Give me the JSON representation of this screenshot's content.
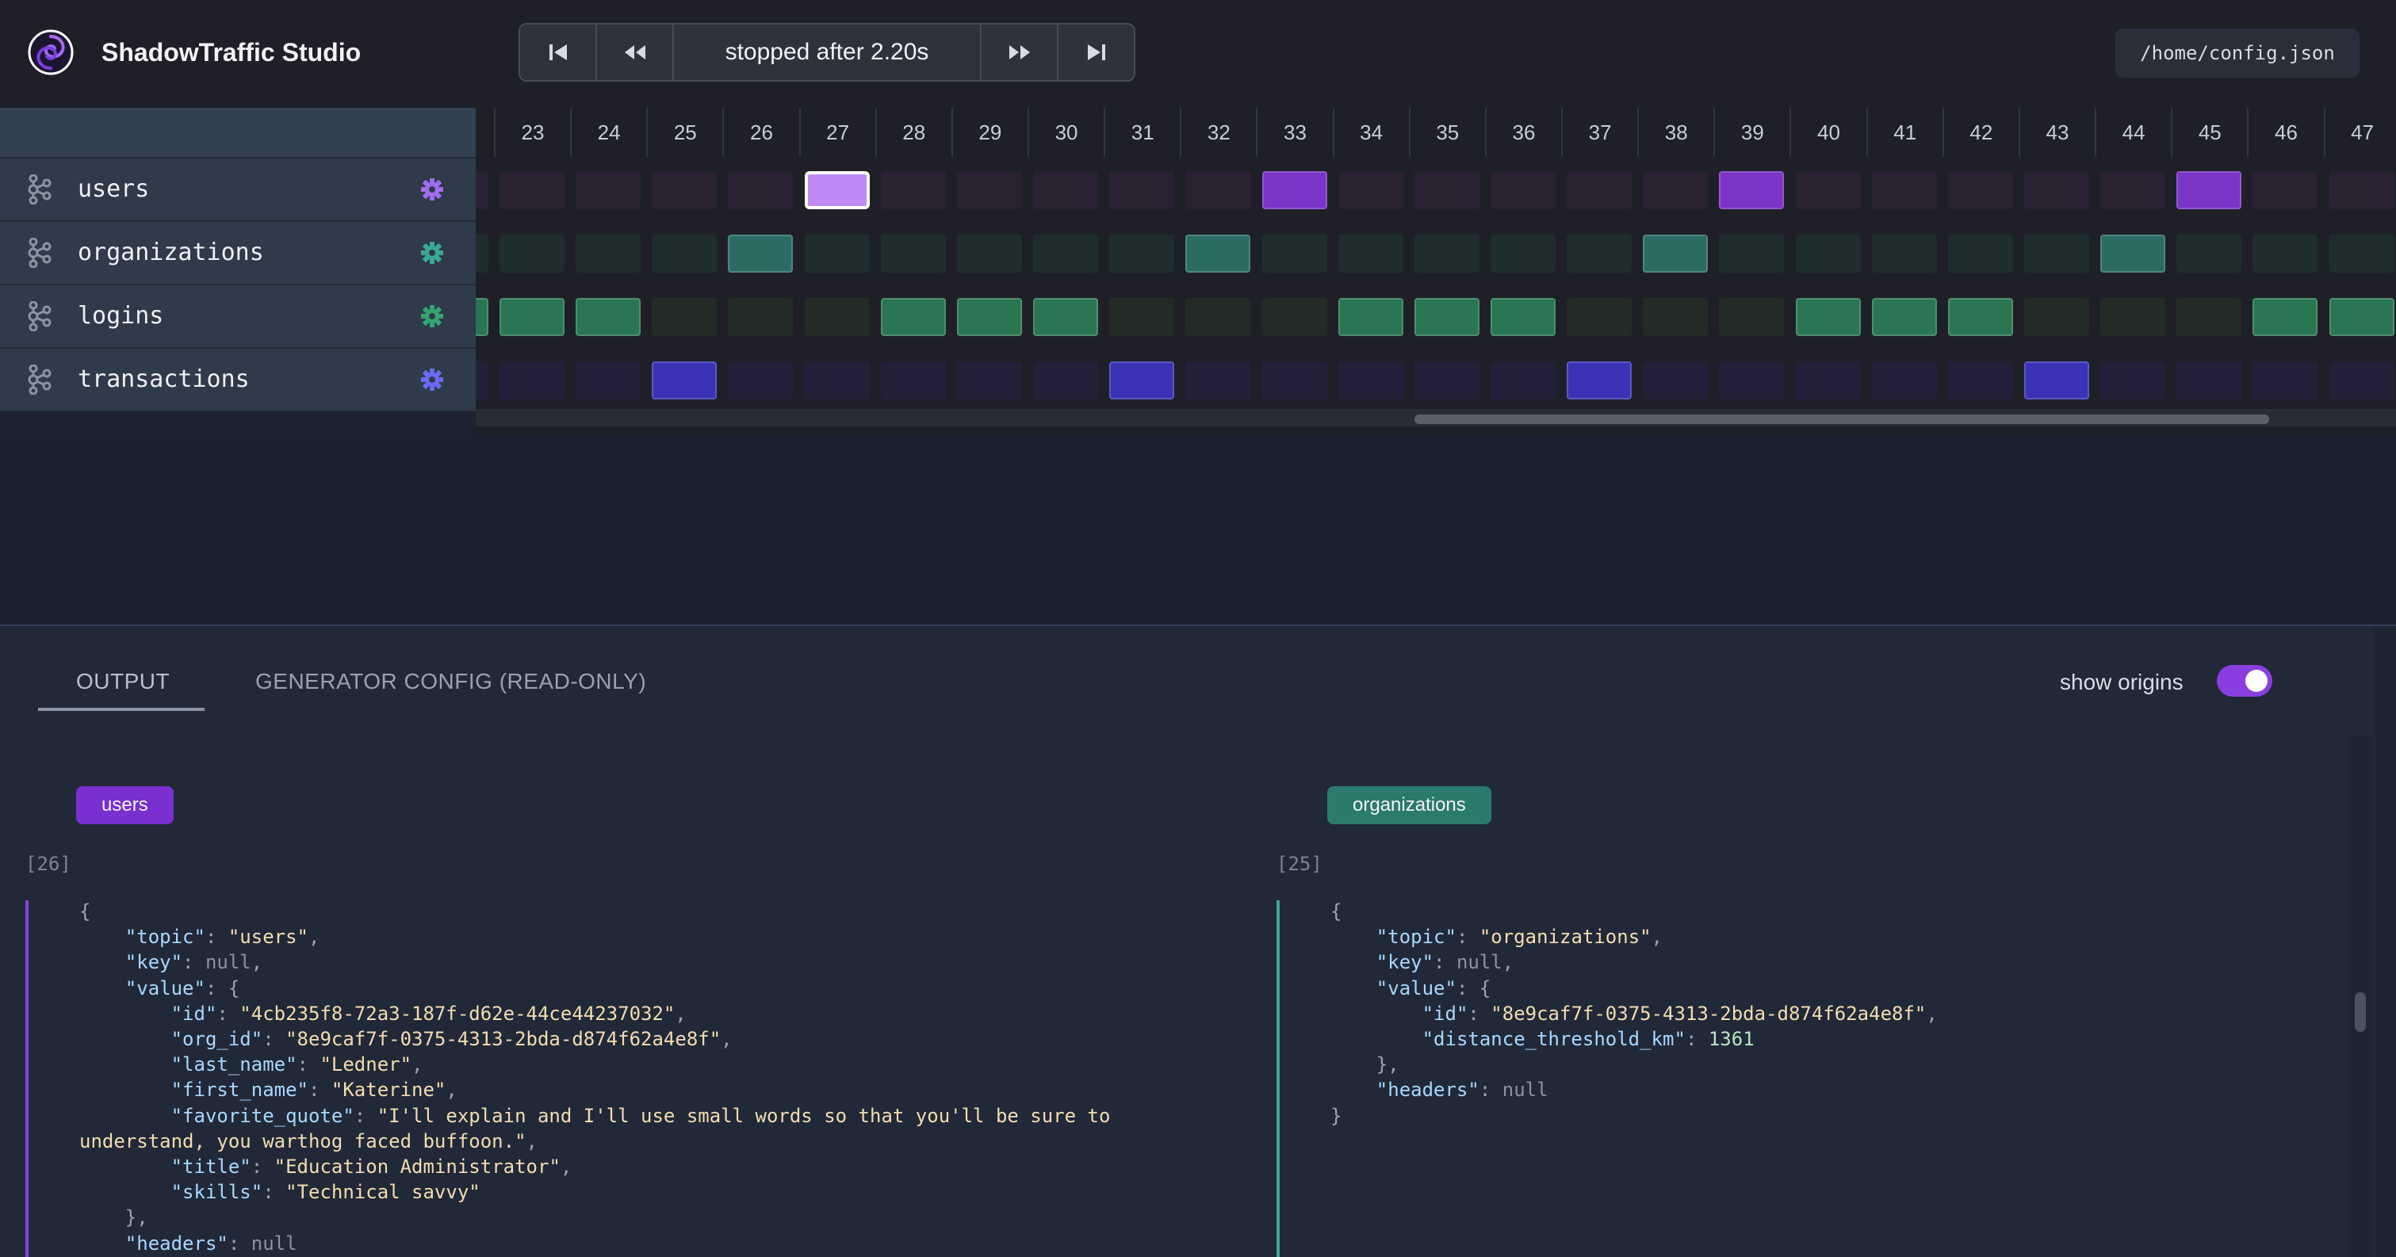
{
  "app": {
    "title": "ShadowTraffic Studio",
    "logo_icon": "spiral-logo-icon"
  },
  "player": {
    "status": "stopped after 2.20s",
    "buttons": [
      "skip-to-start-icon",
      "step-back-icon",
      "step-forward-icon",
      "skip-to-end-icon"
    ]
  },
  "config_path": "/home/config.json",
  "streams": [
    {
      "name": "users",
      "icon": "kafka-icon",
      "settings_icon": "gear-icon",
      "color": "#8b3ee0"
    },
    {
      "name": "organizations",
      "icon": "kafka-icon",
      "settings_icon": "gear-icon",
      "color": "#2f7d72"
    },
    {
      "name": "logins",
      "icon": "kafka-icon",
      "settings_icon": "gear-icon",
      "color": "#2e7d57"
    },
    {
      "name": "transactions",
      "icon": "kafka-icon",
      "settings_icon": "gear-icon",
      "color": "#4a3cc8"
    }
  ],
  "timeline": {
    "ticks": [
      "23",
      "24",
      "25",
      "26",
      "27",
      "28",
      "29",
      "30",
      "31",
      "32",
      "33",
      "34",
      "35",
      "36",
      "37",
      "38",
      "39",
      "40",
      "41",
      "42",
      "43",
      "44",
      "45",
      "46",
      "47"
    ],
    "events": {
      "users": [
        "33",
        "39",
        "45"
      ],
      "users_selected": "27",
      "organizations": [
        "26",
        "32",
        "38",
        "44"
      ],
      "logins": [
        "23",
        "24",
        "28",
        "29",
        "30",
        "34",
        "35",
        "36",
        "40",
        "41",
        "42",
        "46",
        "47"
      ],
      "transactions": [
        "25",
        "31",
        "37",
        "43"
      ]
    },
    "colors": {
      "users_empty": "#2a2232",
      "users_event": "#7a34c8",
      "users_selected": "#c08af5",
      "organizations_empty": "#1f2d2d",
      "organizations_event": "#2b6b64",
      "logins_empty": "#232b27",
      "logins_event": "#2a7552",
      "transactions_empty": "#23213a",
      "transactions_event": "#3b32b5"
    }
  },
  "tabs": {
    "output": "OUTPUT",
    "generator_config": "GENERATOR CONFIG (READ-ONLY)"
  },
  "show_origins": {
    "label": "show origins",
    "enabled": true
  },
  "outputs": [
    {
      "badge": "users",
      "seq": "[26]",
      "lines": [
        "{",
        "    \"topic\": \"users\",",
        "    \"key\": null,",
        "    \"value\": {",
        "        \"id\": \"4cb235f8-72a3-187f-d62e-44ce44237032\",",
        "        \"org_id\": \"8e9caf7f-0375-4313-2bda-d874f62a4e8f\",",
        "        \"last_name\": \"Ledner\",",
        "        \"first_name\": \"Katerine\",",
        "        \"favorite_quote\": \"I'll explain and I'll use small words so that you'll be sure to",
        "understand, you warthog faced buffoon.\",",
        "        \"title\": \"Education Administrator\",",
        "        \"skills\": \"Technical savvy\"",
        "    },",
        "    \"headers\": null"
      ]
    },
    {
      "badge": "organizations",
      "seq": "[25]",
      "lines": [
        "{",
        "    \"topic\": \"organizations\",",
        "    \"key\": null,",
        "    \"value\": {",
        "        \"id\": \"8e9caf7f-0375-4313-2bda-d874f62a4e8f\",",
        "        \"distance_threshold_km\": 1361",
        "    },",
        "    \"headers\": null",
        "}"
      ]
    }
  ]
}
